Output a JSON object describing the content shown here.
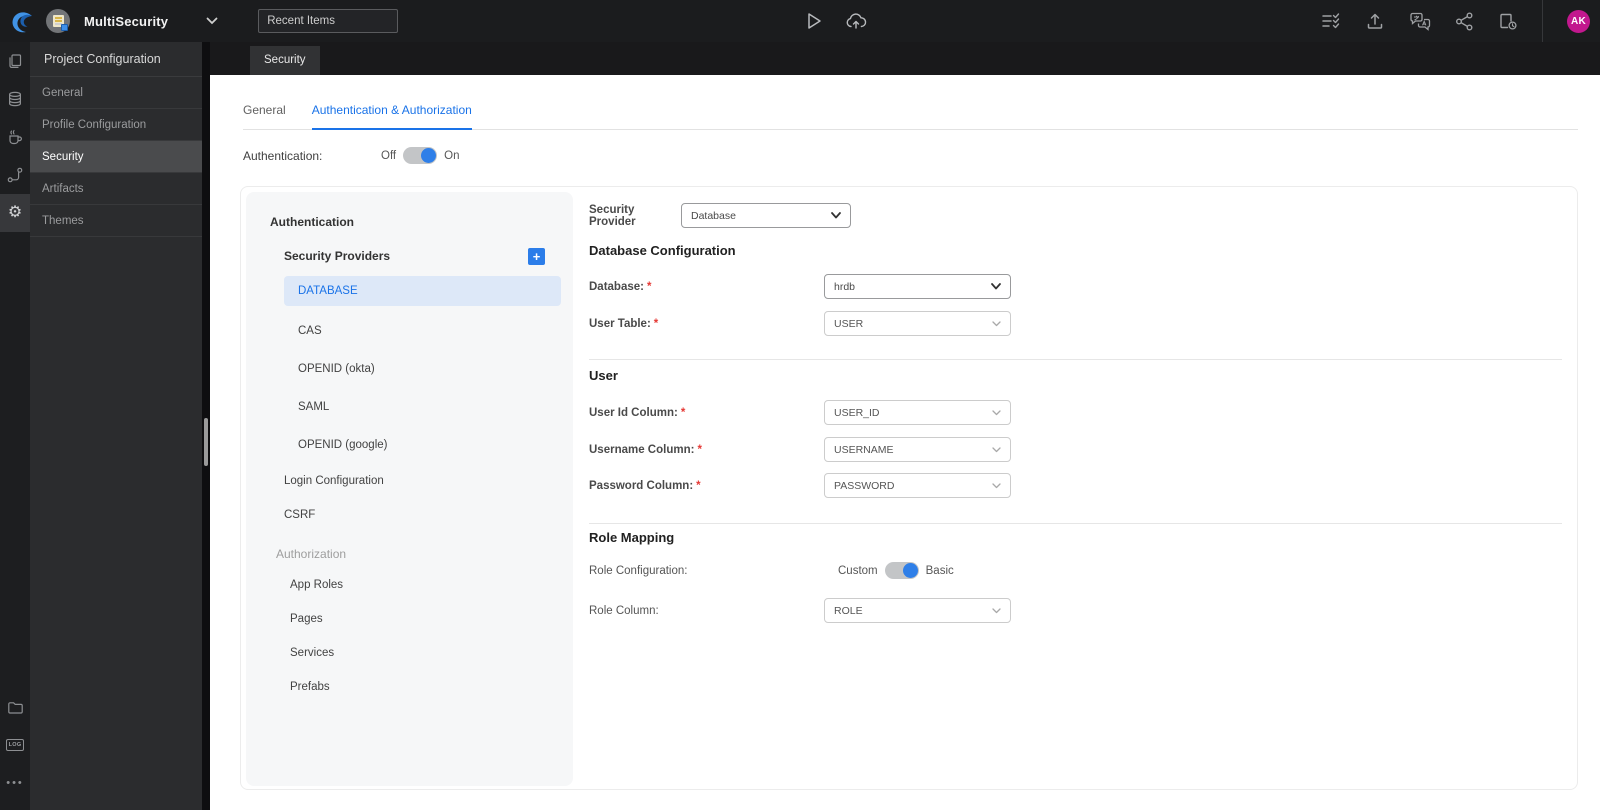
{
  "topbar": {
    "project_name": "MultiSecurity",
    "recent_items_placeholder": "Recent Items",
    "avatar_initials": "AK",
    "left_icons": [
      "wavemaker-logo",
      "project-icon",
      "chevron-down"
    ],
    "center_icons": [
      "run-play",
      "deploy-cloud-upload"
    ],
    "right_icons": [
      "task-list",
      "export",
      "translate",
      "share",
      "file-history"
    ]
  },
  "rail": {
    "icons": [
      "pages",
      "database",
      "java-services",
      "apis",
      "settings",
      "folder",
      "logs",
      "more"
    ],
    "active_icon": "settings",
    "log_icon_text": "LOG"
  },
  "sidebar": {
    "title": "Project Configuration",
    "items": [
      "General",
      "Profile Configuration",
      "Security",
      "Artifacts",
      "Themes"
    ],
    "active_item": "Security"
  },
  "editor": {
    "tab_label": "Security"
  },
  "tabs": {
    "general": "General",
    "auth": "Authentication & Authorization",
    "active": "Authentication & Authorization"
  },
  "authentication_toggle": {
    "label": "Authentication:",
    "off_label": "Off",
    "on_label": "On",
    "state": "on"
  },
  "nav_panel": {
    "authentication_section": "Authentication",
    "security_providers_label": "Security Providers",
    "providers": [
      "DATABASE",
      "CAS",
      "OPENID (okta)",
      "SAML",
      "OPENID (google)"
    ],
    "selected_provider": "DATABASE",
    "login_configuration": "Login Configuration",
    "csrf": "CSRF",
    "authorization_section": "Authorization",
    "authorization_items": [
      "App Roles",
      "Pages",
      "Services",
      "Prefabs"
    ]
  },
  "form": {
    "required_marker": "*",
    "security_provider": {
      "label": "Security Provider",
      "value": "Database"
    },
    "database_config": {
      "title": "Database Configuration",
      "database": {
        "label": "Database:",
        "value": "hrdb"
      },
      "user_table": {
        "label": "User Table:",
        "value": "USER"
      }
    },
    "user": {
      "title": "User",
      "user_id": {
        "label": "User Id Column:",
        "value": "USER_ID"
      },
      "username": {
        "label": "Username Column:",
        "value": "USERNAME"
      },
      "password": {
        "label": "Password Column:",
        "value": "PASSWORD"
      }
    },
    "role_mapping": {
      "title": "Role Mapping",
      "role_configuration": {
        "label": "Role Configuration:",
        "left_label": "Custom",
        "right_label": "Basic",
        "state": "basic"
      },
      "role_column": {
        "label": "Role Column:",
        "value": "ROLE"
      }
    }
  },
  "colors": {
    "accent_blue": "#1a73e8",
    "selected_provider_bg": "#dde8f8",
    "toggle_knob_blue": "#2f7fe8",
    "avatar_bg": "#c2188e",
    "required_red": "#e53935",
    "topbar_bg": "#1b1c1e",
    "sidebar_bg": "#2b2c2e"
  }
}
